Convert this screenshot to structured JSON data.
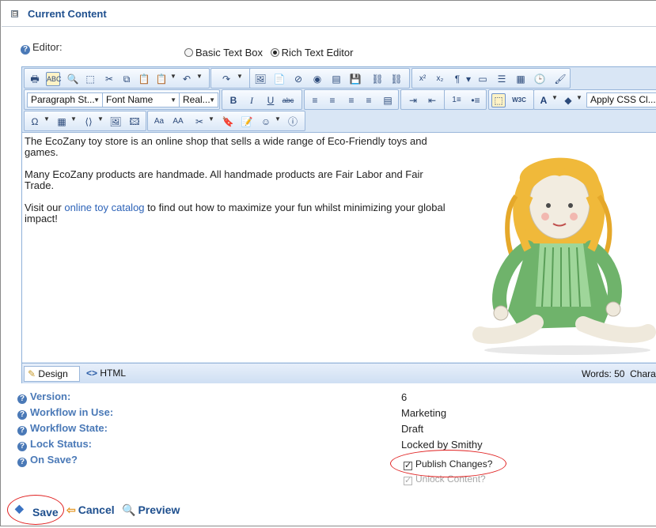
{
  "section": {
    "title": "Current Content",
    "collapse_glyph": "⊟"
  },
  "editor_option": {
    "label": "Editor:",
    "options": [
      {
        "label": "Basic Text Box",
        "selected": false
      },
      {
        "label": "Rich Text Editor",
        "selected": true
      }
    ]
  },
  "toolbar": {
    "paragraph_style": "Paragraph St...",
    "font_name": "Font Name",
    "font_size": "Real...",
    "css_class": "Apply CSS Cl..."
  },
  "content": {
    "p1": "The EcoZany toy store is an online shop that sells a wide range of Eco-Friendly toys and games.",
    "p2": "Many EcoZany products are handmade. All handmade products are Fair Labor and Fair Trade.",
    "p3_before": "Visit our ",
    "p3_link": "online toy catalog",
    "p3_after": " to find out how to maximize your fun whilst minimizing your global impact!"
  },
  "footer": {
    "design_tab": "Design",
    "html_tab": "HTML",
    "words": "Words: 50",
    "chars": "Chara"
  },
  "properties": [
    {
      "label": "Version:",
      "value": "6"
    },
    {
      "label": "Workflow in Use:",
      "value": "Marketing"
    },
    {
      "label": "Workflow State:",
      "value": "Draft"
    },
    {
      "label": "Lock Status:",
      "value": "Locked by Smithy"
    },
    {
      "label": "On Save?",
      "value": ""
    }
  ],
  "on_save": {
    "publish_label": "Publish Changes?",
    "publish_checked": true,
    "unlock_label": "Unlock Content?",
    "unlock_checked": true
  },
  "actions": {
    "save": "Save",
    "cancel": "Cancel",
    "preview": "Preview"
  },
  "colors": {
    "accent": "#1e4f8e",
    "label_blue": "#4a79b7",
    "highlight": "#e02020",
    "toolbar_bg": "#d9e6f5"
  }
}
